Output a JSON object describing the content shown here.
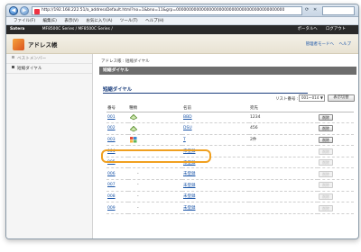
{
  "browser": {
    "url": "http://192.168.222.51/a_addressDefault.html?no=1&bno=11&grp=0000000000000000000000000000000000000000000",
    "back_icon": "back-arrow-icon",
    "forward_icon": "forward-arrow-icon"
  },
  "menu": {
    "items": [
      "ファイル(F)",
      "編集(E)",
      "表示(V)",
      "お気に入り(A)",
      "ツール(T)",
      "ヘルプ(H)"
    ]
  },
  "brand": {
    "company": "Satera",
    "model": "MF8500C Series / MF8500C Series /",
    "links": [
      "ポータルへ",
      "ログアウト"
    ]
  },
  "header": {
    "title": "アドレス帳",
    "links": [
      "管理者モードへ",
      "ヘルプ"
    ]
  },
  "sidebar": {
    "items": [
      {
        "label": "ベストメンバー"
      },
      {
        "label": "短縮ダイヤル"
      }
    ]
  },
  "main": {
    "breadcrumb": "アドレス帳 : 短縮ダイヤル",
    "section_title": "短縮ダイヤル",
    "sub_title": "短縮ダイヤル",
    "list_number_label": "リスト番号 :",
    "list_select_value": "001～014",
    "show_list_button": "表示切替",
    "columns": [
      "番号",
      "種類",
      "名前",
      "宛先",
      ""
    ],
    "delete_label": "削除",
    "rows": [
      {
        "no": "001",
        "type": "fax-icon",
        "name": "BBD",
        "dest": "1234",
        "registered": true
      },
      {
        "no": "002",
        "type": "fax-icon",
        "name": "DSU",
        "dest": "456",
        "registered": true
      },
      {
        "no": "003",
        "type": "group-icon",
        "name": "T",
        "dest": "2件",
        "registered": true
      },
      {
        "no": "004",
        "type": "-",
        "name": "未登録",
        "dest": "",
        "registered": false
      },
      {
        "no": "005",
        "type": "-",
        "name": "未登録",
        "dest": "",
        "registered": false
      },
      {
        "no": "006",
        "type": "-",
        "name": "未登録",
        "dest": "",
        "registered": false
      },
      {
        "no": "007",
        "type": "-",
        "name": "未登録",
        "dest": "",
        "registered": false
      },
      {
        "no": "008",
        "type": "-",
        "name": "未登録",
        "dest": "",
        "registered": false
      },
      {
        "no": "009",
        "type": "-",
        "name": "未登録",
        "dest": "",
        "registered": false
      }
    ]
  },
  "colors": {
    "brand_bar": "#2a2a2a",
    "section_head": "#6d6d6d",
    "link": "#1a55a8",
    "highlight": "#f0a020"
  }
}
